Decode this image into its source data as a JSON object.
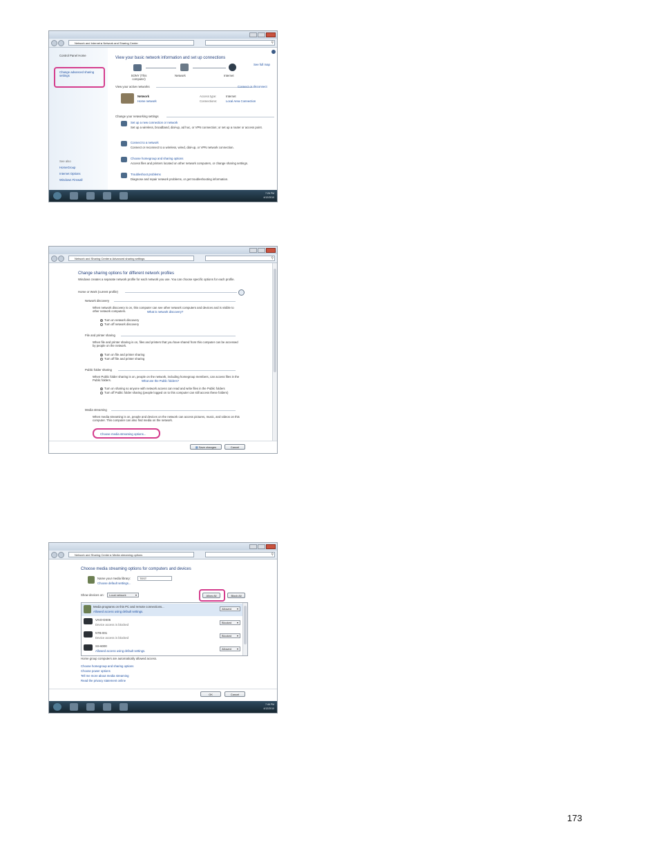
{
  "page_number": "173",
  "shot1": {
    "address": "Network and Internet ▸ Network and Sharing Center",
    "sidebar_home": "Control Panel Home",
    "sidebar_link": "Change advanced sharing settings",
    "see_also": [
      "See also",
      "HomeGroup",
      "Internet Options",
      "Windows Firewall"
    ],
    "heading": "View your basic network information and set up connections",
    "see_full_map": "See full map",
    "map_nodes": [
      "SONY (This computer)",
      "Network",
      "Internet"
    ],
    "active_networks_label": "View your active networks",
    "connect_disconnect": "Connect or disconnect",
    "network_name": "Network",
    "network_type": "Home network",
    "access_type_label": "Access type:",
    "access_type_value": "Internet",
    "connections_label": "Connections:",
    "connections_value": "Local Area Connection",
    "change_settings_label": "Change your networking settings",
    "tasks": [
      {
        "title": "Set up a new connection or network",
        "desc": "Set up a wireless, broadband, dial-up, ad hoc, or VPN connection; or set up a router or access point."
      },
      {
        "title": "Connect to a network",
        "desc": "Connect or reconnect to a wireless, wired, dial-up, or VPN network connection."
      },
      {
        "title": "Choose homegroup and sharing options",
        "desc": "Access files and printers located on other network computers, or change sharing settings."
      },
      {
        "title": "Troubleshoot problems",
        "desc": "Diagnose and repair network problems, or get troubleshooting information."
      }
    ],
    "tray_time": "7:26 PM",
    "tray_date": "4/12/2010"
  },
  "shot2": {
    "address": "Network and Sharing Center ▸ Advanced sharing settings",
    "heading": "Change sharing options for different network profiles",
    "intro": "Windows creates a separate network profile for each network you use. You can choose specific options for each profile.",
    "profile": "Home or Work (current profile)",
    "sections": [
      {
        "title": "Network discovery",
        "desc": "When network discovery is on, this computer can see other network computers and devices and is visible to other network computers.",
        "link": "What is network discovery?",
        "options": [
          "Turn on network discovery",
          "Turn off network discovery"
        ]
      },
      {
        "title": "File and printer sharing",
        "desc": "When file and printer sharing is on, files and printers that you have shared from this computer can be accessed by people on the network.",
        "options": [
          "Turn on file and printer sharing",
          "Turn off file and printer sharing"
        ]
      },
      {
        "title": "Public folder sharing",
        "desc": "When Public folder sharing is on, people on the network, including homegroup members, can access files in the Public folders.",
        "link": "What are the Public folders?",
        "options": [
          "Turn on sharing so anyone with network access can read and write files in the Public folders",
          "Turn off Public folder sharing (people logged on to this computer can still access these folders)"
        ]
      },
      {
        "title": "Media streaming",
        "desc": "When media streaming is on, people and devices on the network can access pictures, music, and videos on this computer. This computer can also find media on the network."
      }
    ],
    "media_link": "Choose media streaming options...",
    "save_button": "Save changes",
    "cancel_button": "Cancel"
  },
  "shot3": {
    "address": "Network and Sharing Center ▸ Media streaming options",
    "heading": "Choose media streaming options for computers and devices",
    "library_label": "Name your media library:",
    "library_value": "TEST",
    "default_settings_link": "Choose default settings...",
    "show_devices_label": "Show devices on:",
    "show_devices_value": "Local network",
    "allow_all_button": "Allow All",
    "block_all_button": "Block All",
    "devices": [
      {
        "name": "Media programs on this PC and remote connections...",
        "status": "Allowed access using default settings.",
        "value": "Allowed"
      },
      {
        "name": "VAIO-DS06",
        "status": "Device access is blocked",
        "value": "Blocked"
      },
      {
        "name": "NTB-001",
        "status": "Device access is blocked",
        "value": "Blocked"
      },
      {
        "name": "SS-6000",
        "status": "Allowed access using default settings.",
        "value": "Allowed"
      }
    ],
    "homegroup_note": "Home group computers are automatically allowed access.",
    "links": [
      "Choose homegroup and sharing options",
      "Choose power options",
      "Tell me more about media streaming",
      "Read the privacy statement online"
    ],
    "ok_button": "OK",
    "cancel_button": "Cancel",
    "tray_time": "7:46 PM",
    "tray_date": "4/12/2010"
  },
  "colors": {
    "highlight": "#d43b8c",
    "link": "#1e50a2",
    "heading": "#1f3d7a"
  }
}
